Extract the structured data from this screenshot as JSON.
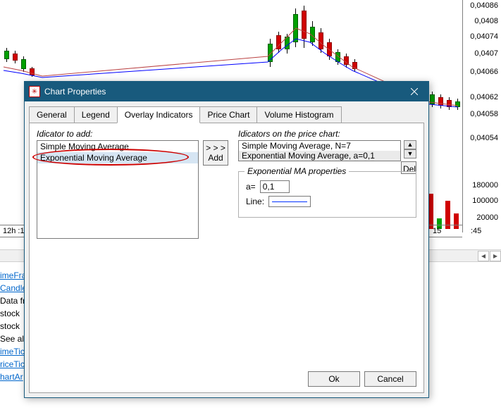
{
  "price_ticks": [
    "0,04086",
    "0,0408",
    "0,04074",
    "0,0407",
    "0,04066",
    "0,04062",
    "0,04058",
    "0,04054"
  ],
  "vol_ticks": [
    "180000",
    "100000",
    "20000"
  ],
  "time_ticks": {
    "left": "12h :1",
    "mid": "15",
    "right": ":45"
  },
  "left_links": [
    {
      "text": "imeFra",
      "plain": false
    },
    {
      "text": "Candle",
      "plain": false
    },
    {
      "text": "Data fr",
      "plain": true
    },
    {
      "text": "  stock",
      "plain": true
    },
    {
      "text": "  stock",
      "plain": true
    },
    {
      "text": "See al",
      "plain": true
    },
    {
      "text": "imeTic",
      "plain": false
    },
    {
      "text": "riceTic",
      "plain": false
    },
    {
      "text": "hartAr",
      "plain": false
    }
  ],
  "dialog": {
    "title": "Chart Properties",
    "tabs": [
      "General",
      "Legend",
      "Overlay Indicators",
      "Price Chart",
      "Volume Histogram"
    ],
    "active_tab": 2,
    "left_label": "Idicator to add:",
    "left_items": [
      "Simple Moving Average",
      "Exponential Moving Average"
    ],
    "left_selected": 1,
    "add_label_top": "> > >",
    "add_label_bot": "Add",
    "right_label": "Idicators on the price chart:",
    "right_items": [
      "Simple Moving Average, N=7",
      "Exponential Moving Average, a=0,1"
    ],
    "right_selected": 1,
    "del_label": "Del",
    "props_legend": "Exponential MA properties",
    "a_label": "a=",
    "a_value": "0,1",
    "line_label": "Line:",
    "ok": "Ok",
    "cancel": "Cancel"
  }
}
